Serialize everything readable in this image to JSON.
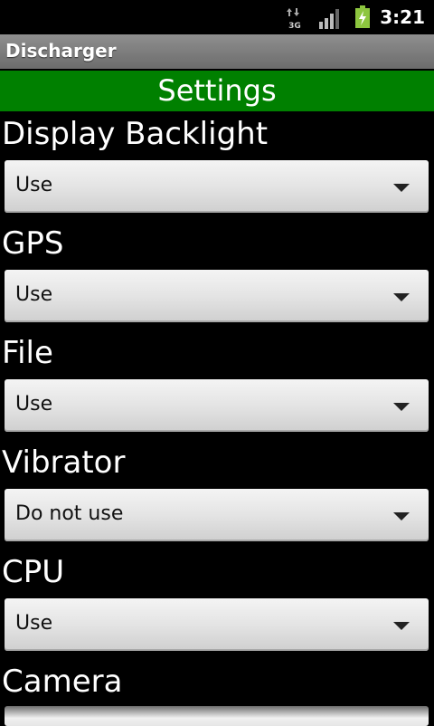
{
  "status_bar": {
    "network_label": "3G",
    "time": "3:21"
  },
  "app": {
    "title": "Discharger"
  },
  "header": {
    "title": "Settings"
  },
  "settings": [
    {
      "label": "Display Backlight",
      "value": "Use"
    },
    {
      "label": "GPS",
      "value": "Use"
    },
    {
      "label": "File",
      "value": "Use"
    },
    {
      "label": "Vibrator",
      "value": "Do not use"
    },
    {
      "label": "CPU",
      "value": "Use"
    },
    {
      "label": "Camera",
      "value": ""
    }
  ],
  "colors": {
    "header_green": "#008000",
    "title_bar_gray": "#7a7a7a",
    "battery_green": "#8dc63f"
  },
  "icons": [
    "data-transfer-3g-icon",
    "signal-strength-icon",
    "battery-charging-icon",
    "dropdown-arrow-icon"
  ]
}
